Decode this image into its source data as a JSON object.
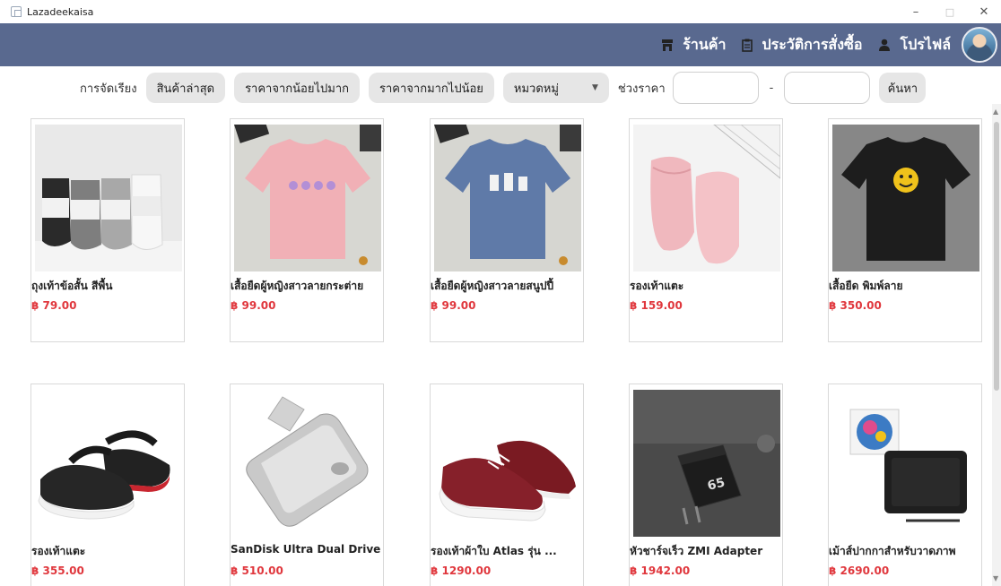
{
  "window": {
    "title": "Lazadeekaisa",
    "minimize": "–",
    "maximize": "□",
    "close": "✕"
  },
  "header": {
    "nav": [
      {
        "label": "ร้านค้า",
        "icon": "store-icon"
      },
      {
        "label": "ประวัติการสั่งซื้อ",
        "icon": "clipboard-icon"
      },
      {
        "label": "โปรไฟล์",
        "icon": "user-icon"
      }
    ],
    "color": "#59698f"
  },
  "filters": {
    "sort_label": "การจัดเรียง",
    "sort_options": [
      "สินค้าล่าสุด",
      "ราคาจากน้อยไปมาก",
      "ราคาจากมากไปน้อย"
    ],
    "category_selected": "หมวดหมู่",
    "price_label": "ช่วงราคา",
    "min_price": "",
    "max_price": "",
    "dash": "-",
    "search_label": "ค้นหา"
  },
  "products": [
    {
      "name": "ถุงเท้าข้อสั้น สีพื้น",
      "price": "฿ 79.00",
      "image": "socks"
    },
    {
      "name": "เสื้อยืดผู้หญิงสาวลายกระต่าย",
      "price": "฿ 99.00",
      "image": "pink-tshirt"
    },
    {
      "name": "เสื้อยืดผู้หญิงสาวลายสนูปปี้",
      "price": "฿ 99.00",
      "image": "blue-tshirt"
    },
    {
      "name": "รองเท้าแตะ",
      "price": "฿ 159.00",
      "image": "pink-slippers"
    },
    {
      "name": "เสื้อยืด พิมพ์ลาย",
      "price": "฿ 350.00",
      "image": "black-tshirt"
    },
    {
      "name": "รองเท้าแตะ",
      "price": "฿ 355.00",
      "image": "black-clogs"
    },
    {
      "name": "SanDisk Ultra Dual Drive",
      "price": "฿ 510.00",
      "image": "usb-drive"
    },
    {
      "name": "รองเท้าผ้าใบ Atlas รุ่น ...",
      "price": "฿ 1290.00",
      "image": "red-sneakers"
    },
    {
      "name": "หัวชาร์จเร็ว ZMI Adapter",
      "price": "฿ 1942.00",
      "image": "charger"
    },
    {
      "name": "เม้าส์ปากกาสำหรับวาดภาพ",
      "price": "฿ 2690.00",
      "image": "pen-tablet"
    }
  ],
  "price_color": "#e0373d"
}
